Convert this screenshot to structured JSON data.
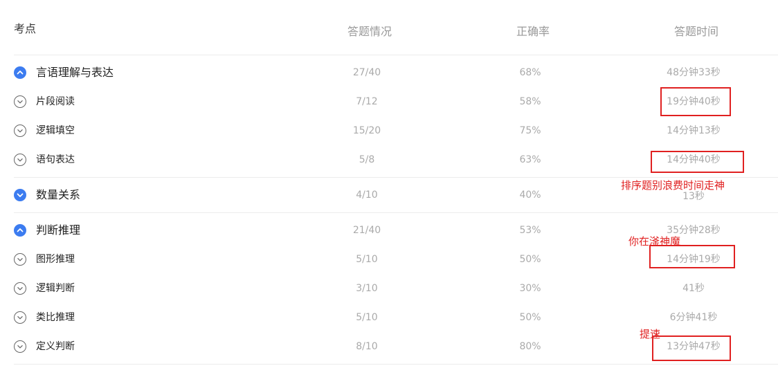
{
  "header": {
    "col_topic": "考点",
    "col_answered": "答题情况",
    "col_accuracy": "正确率",
    "col_time": "答题时间"
  },
  "rows": [
    {
      "name": "言语理解与表达",
      "answered": "27/40",
      "accuracy": "68%",
      "time": "48分钟33秒"
    },
    {
      "name": "片段阅读",
      "answered": "7/12",
      "accuracy": "58%",
      "time": "19分钟40秒"
    },
    {
      "name": "逻辑填空",
      "answered": "15/20",
      "accuracy": "75%",
      "time": "14分钟13秒"
    },
    {
      "name": "语句表达",
      "answered": "5/8",
      "accuracy": "63%",
      "time": "14分钟40秒"
    },
    {
      "name": "数量关系",
      "answered": "4/10",
      "accuracy": "40%",
      "time": "13秒"
    },
    {
      "name": "判断推理",
      "answered": "21/40",
      "accuracy": "53%",
      "time": "35分钟28秒"
    },
    {
      "name": "图形推理",
      "answered": "5/10",
      "accuracy": "50%",
      "time": "14分钟19秒"
    },
    {
      "name": "逻辑判断",
      "answered": "3/10",
      "accuracy": "30%",
      "time": "41秒"
    },
    {
      "name": "类比推理",
      "answered": "5/10",
      "accuracy": "50%",
      "time": "6分钟41秒"
    },
    {
      "name": "定义判断",
      "answered": "8/10",
      "accuracy": "80%",
      "time": "13分钟47秒"
    }
  ],
  "annotations": {
    "note1": "排序题别浪费时间走神",
    "note2": "你在滏神魔",
    "note3": "提速"
  },
  "colors": {
    "accent_blue": "#3c7cf0",
    "annotation_red": "#e02020"
  },
  "icons": {
    "parent": "chevron-up-filled-icon",
    "parent_collapsed": "chevron-down-filled-icon",
    "child": "chevron-down-outline-icon"
  }
}
